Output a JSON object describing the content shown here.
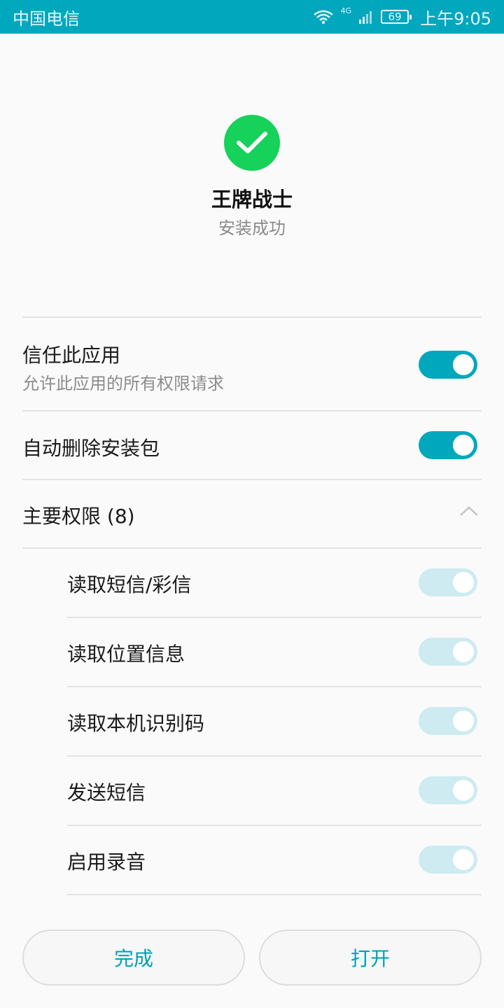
{
  "status_bar": {
    "carrier": "中国电信",
    "network": "4G",
    "battery": "69",
    "time": "上午9:05"
  },
  "app": {
    "name": "王牌战士",
    "status": "安装成功",
    "success_icon": "check-icon",
    "accent_color": "#00a7bd",
    "success_color": "#16d15a"
  },
  "settings": {
    "trust": {
      "title": "信任此应用",
      "subtitle": "允许此应用的所有权限请求",
      "enabled": true
    },
    "auto_delete": {
      "title": "自动删除安装包",
      "enabled": true
    },
    "permissions_header": {
      "title": "主要权限 (8)",
      "expanded": true
    },
    "permissions": [
      {
        "label": "读取短信/彩信",
        "enabled": true
      },
      {
        "label": "读取位置信息",
        "enabled": true
      },
      {
        "label": "读取本机识别码",
        "enabled": true
      },
      {
        "label": "发送短信",
        "enabled": true
      },
      {
        "label": "启用录音",
        "enabled": true
      }
    ]
  },
  "buttons": {
    "done": "完成",
    "open": "打开"
  }
}
